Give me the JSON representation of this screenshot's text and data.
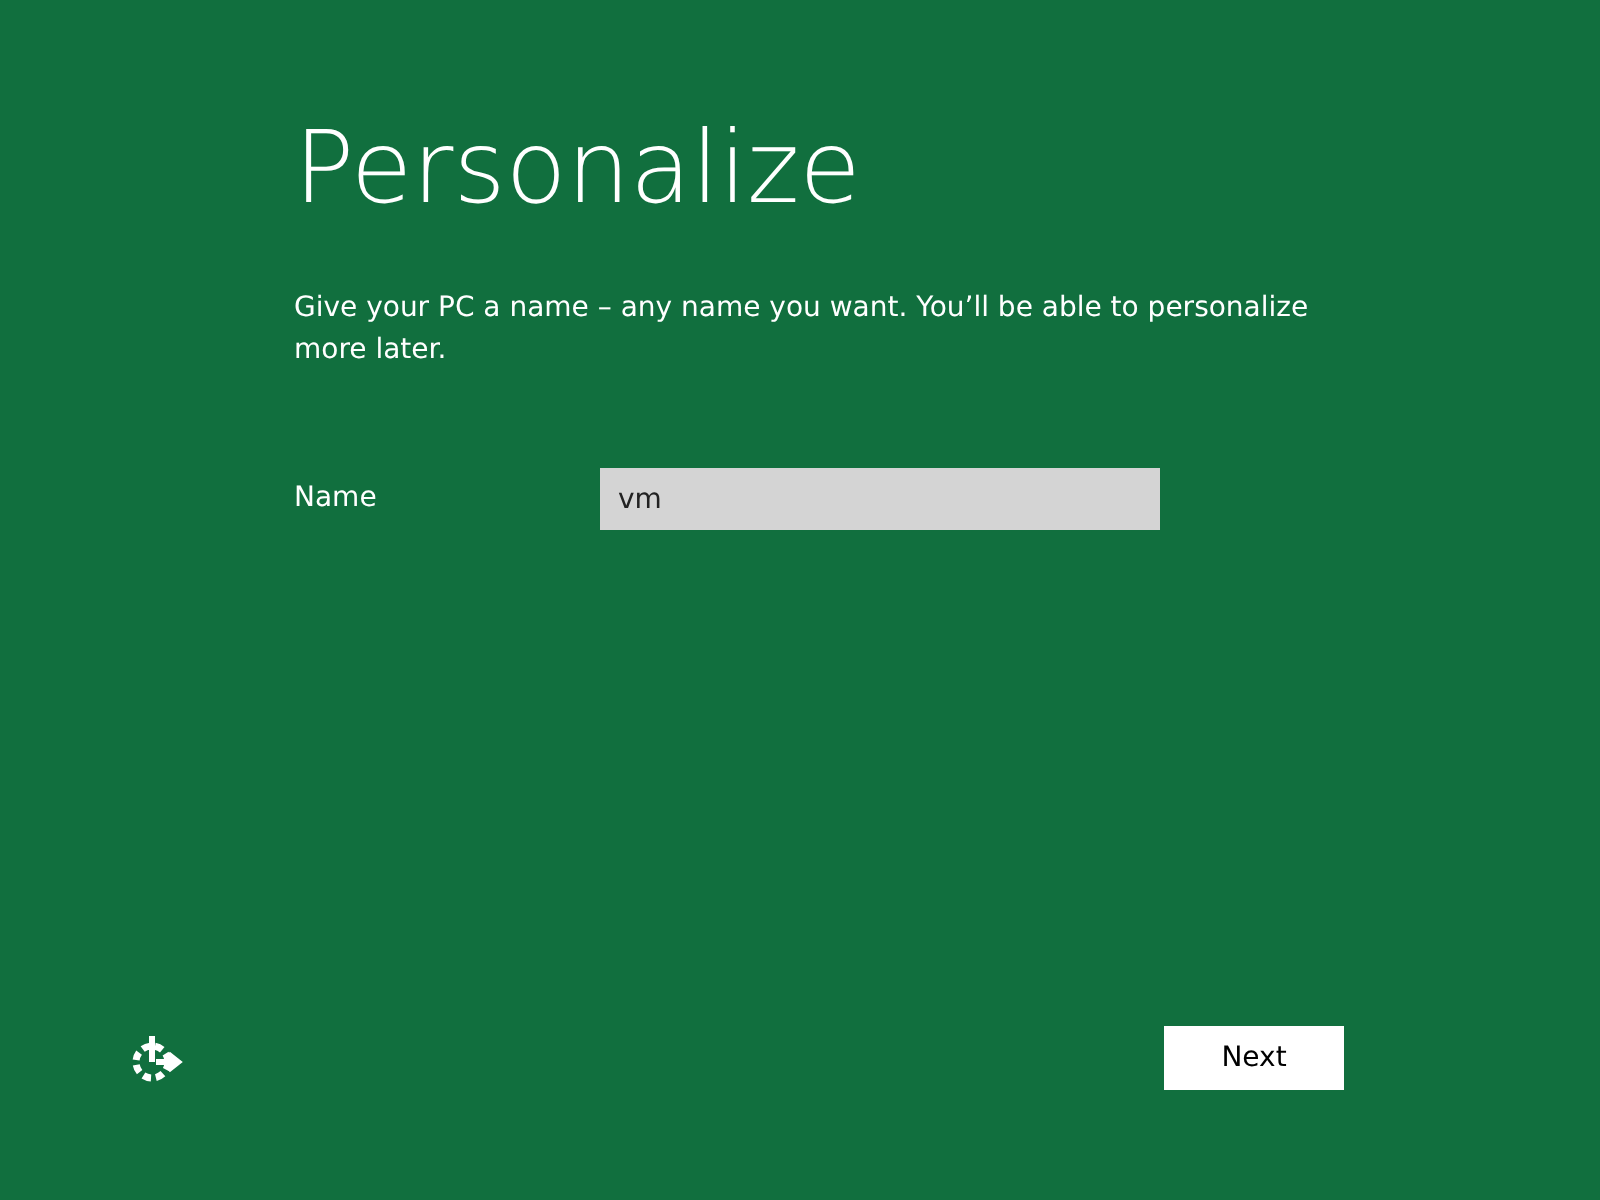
{
  "title": "Personalize",
  "description": "Give your PC a name – any name you want. You’ll be able to personalize more later.",
  "name_field": {
    "label": "Name",
    "value": "vm"
  },
  "next_button": {
    "label": "Next"
  }
}
